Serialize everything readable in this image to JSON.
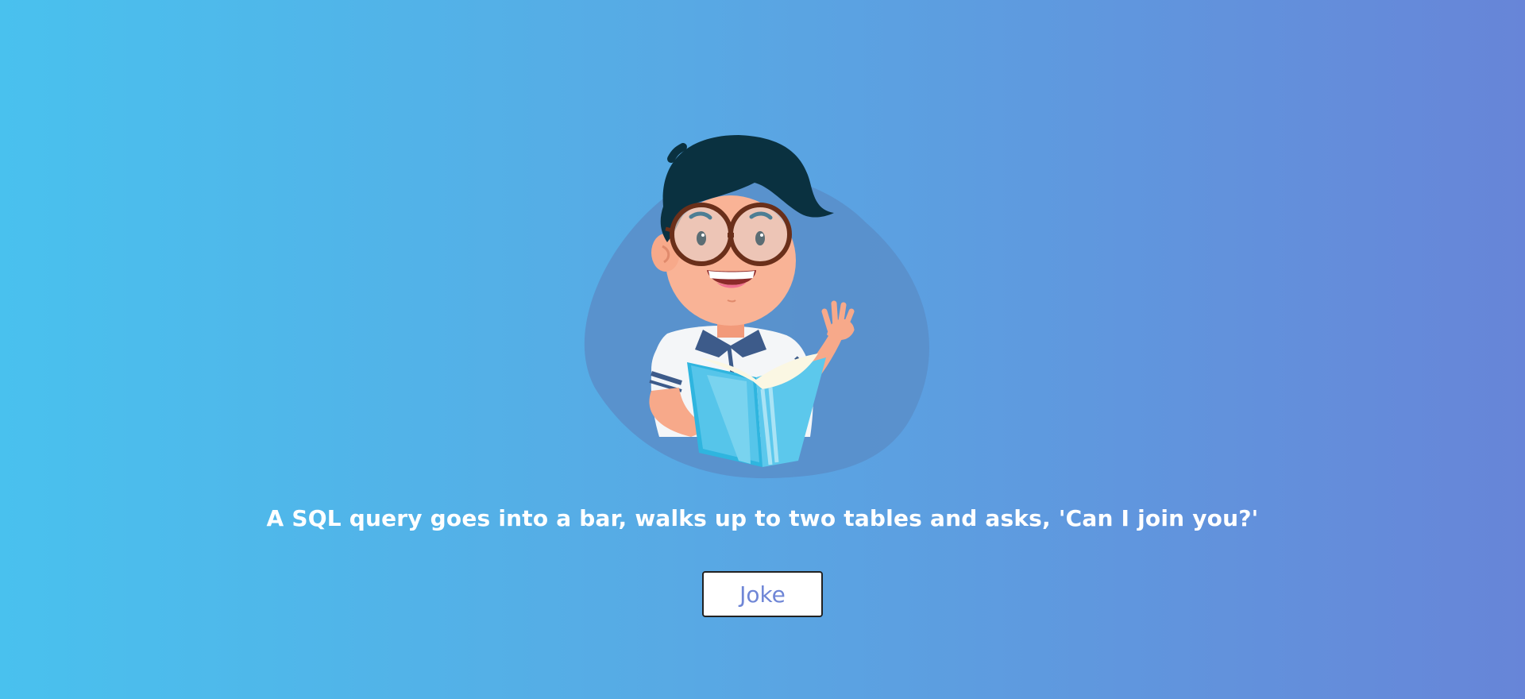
{
  "joke": {
    "text": "A SQL query goes into a bar, walks up to two tables and asks, 'Can I join you?'"
  },
  "button": {
    "label": "Joke"
  },
  "illustration": {
    "icon": "boy-reading-book-illustration"
  },
  "colors": {
    "gradient_start": "#49c1ee",
    "gradient_end": "#6785d8",
    "button_text": "#6f86d6",
    "text": "#ffffff"
  }
}
